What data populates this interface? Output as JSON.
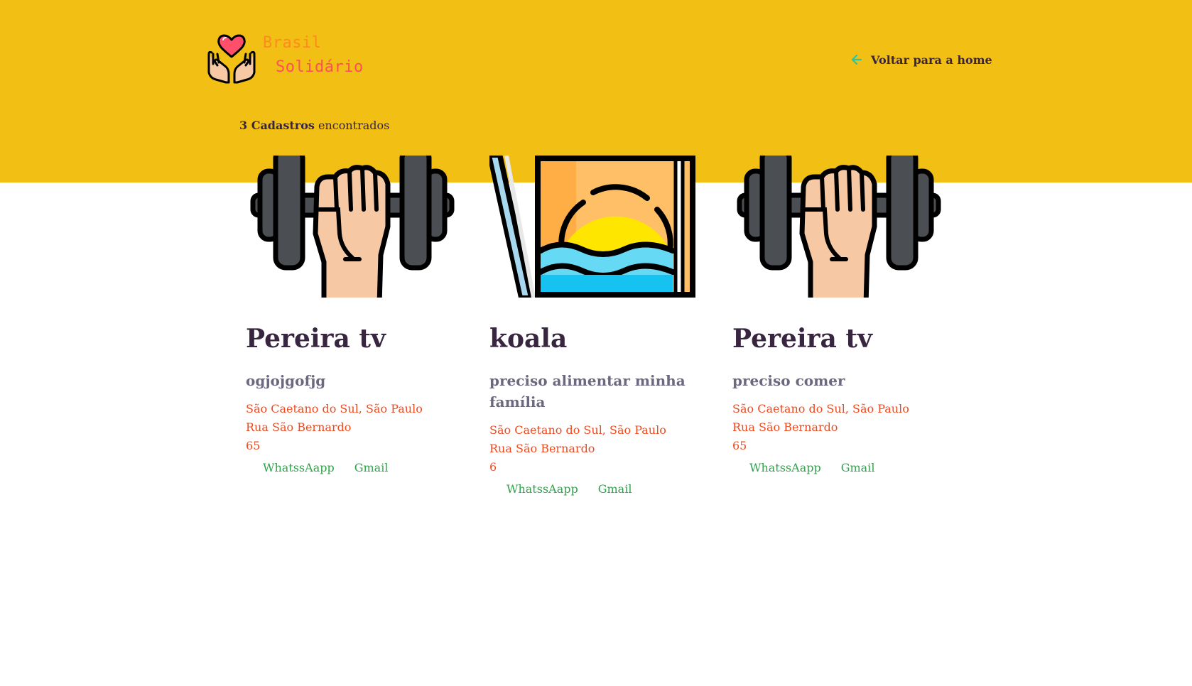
{
  "header": {
    "logo_line1": "Brasil",
    "logo_line2": "Solidário",
    "back_link": "Voltar para a home"
  },
  "results": {
    "count": "3 Cadastros",
    "suffix": " encontrados"
  },
  "cards": [
    {
      "image_icon": "dumbbell-hand-icon",
      "title": "Pereira tv",
      "description": "ogjojgofjg",
      "city": "São Caetano do Sul, São Paulo",
      "street": "Rua São Bernardo",
      "number": "65",
      "whatsapp": "WhatssAapp",
      "gmail": "Gmail"
    },
    {
      "image_icon": "sunset-picture-icon",
      "title": "koala",
      "description": "preciso alimentar minha família",
      "city": "São Caetano do Sul, São Paulo",
      "street": "Rua São Bernardo",
      "number": "6",
      "whatsapp": "WhatssAapp",
      "gmail": "Gmail"
    },
    {
      "image_icon": "dumbbell-hand-icon",
      "title": "Pereira tv",
      "description": "preciso comer",
      "city": "São Caetano do Sul, São Paulo",
      "street": "Rua São Bernardo",
      "number": "65",
      "whatsapp": "WhatssAapp",
      "gmail": "Gmail"
    }
  ],
  "colors": {
    "hero_background": "#f2bf14",
    "title": "#38253f",
    "description": "#6b6880",
    "address": "#ef4a1f",
    "links": "#2ea34a",
    "back_arrow": "#2ec4a0"
  }
}
